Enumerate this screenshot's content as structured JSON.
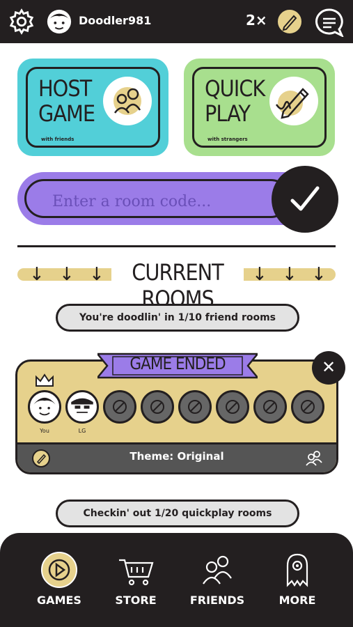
{
  "header": {
    "username": "Doodler981",
    "multiplier": "2×"
  },
  "tiles": {
    "host": {
      "title_line1": "HOST",
      "title_line2": "GAME",
      "subtitle": "with friends",
      "color": "#52cfd8"
    },
    "quick": {
      "title_line1": "QUICK",
      "title_line2": "PLAY",
      "subtitle": "with strangers",
      "color": "#a8df8e"
    }
  },
  "room_code": {
    "placeholder": "Enter a room code..."
  },
  "current_rooms": {
    "title": "CURRENT ROOMS",
    "friend_rooms_text": "You're doodlin' in 1/10 friend rooms",
    "quickplay_rooms_text": "Checkin' out 1/20 quickplay rooms"
  },
  "room_card": {
    "status": "GAME ENDED",
    "players": [
      {
        "label": "You"
      },
      {
        "label": "LG"
      }
    ],
    "empty_slots": 6,
    "theme": "Theme: Original"
  },
  "nav": {
    "items": [
      {
        "label": "GAMES",
        "icon": "play-icon"
      },
      {
        "label": "STORE",
        "icon": "cart-icon"
      },
      {
        "label": "FRIENDS",
        "icon": "friends-icon"
      },
      {
        "label": "MORE",
        "icon": "ghost-icon"
      }
    ]
  },
  "colors": {
    "dark": "#231f20",
    "purple": "#9b7ce8",
    "sand": "#e6d18c"
  }
}
